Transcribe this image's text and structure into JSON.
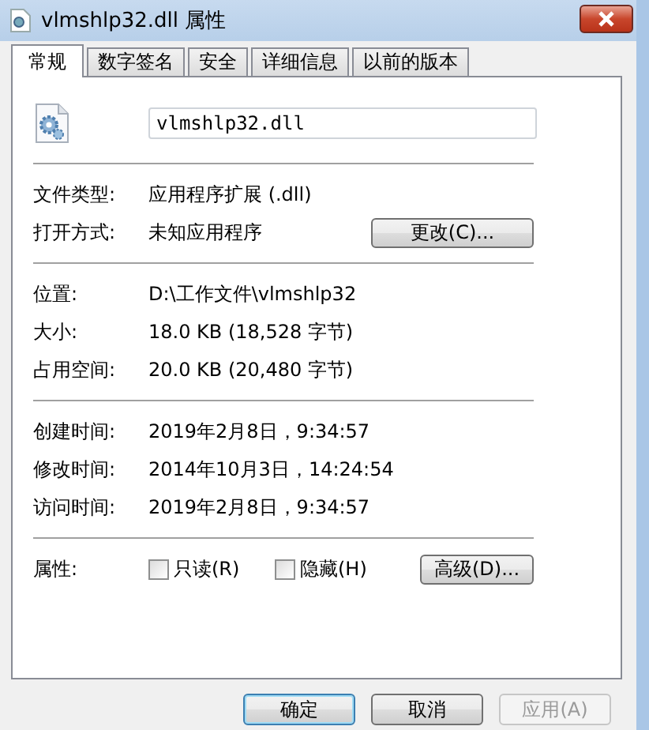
{
  "window": {
    "title": "vlmshlp32.dll 属性"
  },
  "tabs": [
    {
      "label": "常规",
      "selected": true
    },
    {
      "label": "数字签名",
      "selected": false
    },
    {
      "label": "安全",
      "selected": false
    },
    {
      "label": "详细信息",
      "selected": false
    },
    {
      "label": "以前的版本",
      "selected": false
    }
  ],
  "file_name": {
    "value": "vlmshlp32.dll"
  },
  "sections": [
    {
      "rows": [
        {
          "label": "文件类型:",
          "value": "应用程序扩展 (.dll)"
        },
        {
          "label": "打开方式:",
          "value": "未知应用程序",
          "button": "更改(C)..."
        }
      ]
    },
    {
      "rows": [
        {
          "label": "位置:",
          "value": "D:\\工作文件\\vlmshlp32"
        },
        {
          "label": "大小:",
          "value": "18.0 KB (18,528 字节)"
        },
        {
          "label": "占用空间:",
          "value": "20.0 KB (20,480 字节)"
        }
      ]
    },
    {
      "rows": [
        {
          "label": "创建时间:",
          "value": "2019年2月8日，9:34:57"
        },
        {
          "label": "修改时间:",
          "value": "2014年10月3日，14:24:54"
        },
        {
          "label": "访问时间:",
          "value": "2019年2月8日，9:34:57"
        }
      ]
    }
  ],
  "attributes": {
    "label": "属性:",
    "checkboxes": [
      {
        "label": "只读(R)",
        "checked": false
      },
      {
        "label": "隐藏(H)",
        "checked": false
      }
    ],
    "button": "高级(D)..."
  },
  "buttons": [
    {
      "label": "确定",
      "default": true,
      "disabled": false
    },
    {
      "label": "取消",
      "default": false,
      "disabled": false
    },
    {
      "label": "应用(A)",
      "default": false,
      "disabled": true
    }
  ]
}
